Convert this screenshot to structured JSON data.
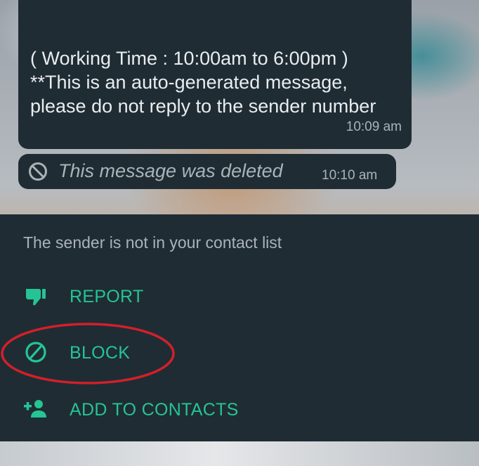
{
  "chat": {
    "message_text": "( Working Time : 10:00am to 6:00pm )\n**This is an auto-generated message, please do not reply to the sender number",
    "message_time": "10:09 am",
    "deleted_text": "This message was deleted",
    "deleted_time": "10:10 am"
  },
  "unknown_sender_panel": {
    "note": "The sender is not in your contact list",
    "actions": [
      {
        "label": "REPORT",
        "icon": "thumbs-down-icon"
      },
      {
        "label": "BLOCK",
        "icon": "block-icon"
      },
      {
        "label": "ADD TO CONTACTS",
        "icon": "add-person-icon"
      }
    ]
  },
  "colors": {
    "bubble": "#1f2c34",
    "accent": "#25c495",
    "secondary_text": "#aab3b8",
    "highlight": "#d2202a"
  }
}
